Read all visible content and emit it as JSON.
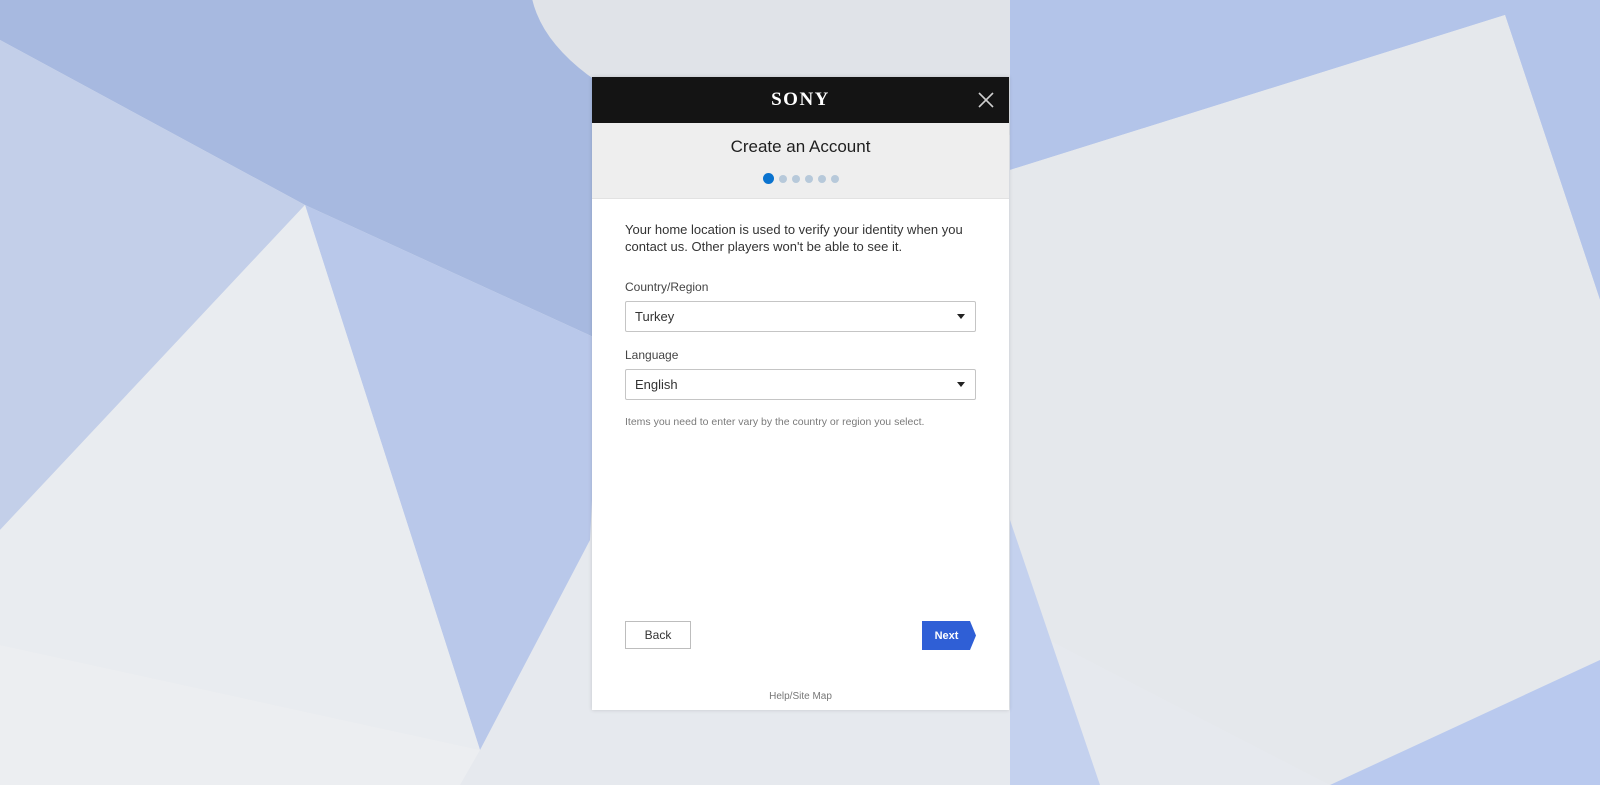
{
  "brand": {
    "logo_text": "SONY"
  },
  "colors": {
    "accent": "#0a73cf",
    "next_button": "#2f5fd6",
    "topbar": "#141414"
  },
  "header": {
    "title": "Create an Account",
    "steps_total": 6,
    "current_step": 1
  },
  "form": {
    "intro": "Your home location is used to verify your identity when you contact us. Other players won't be able to see it.",
    "country_label": "Country/Region",
    "country_value": "Turkey",
    "language_label": "Language",
    "language_value": "English",
    "note": "Items you need to enter vary by the country or region you select."
  },
  "buttons": {
    "back": "Back",
    "next": "Next"
  },
  "footer": {
    "link": "Help/Site Map"
  },
  "icons": {
    "close": "close-icon",
    "dropdown": "chevron-down-icon"
  }
}
